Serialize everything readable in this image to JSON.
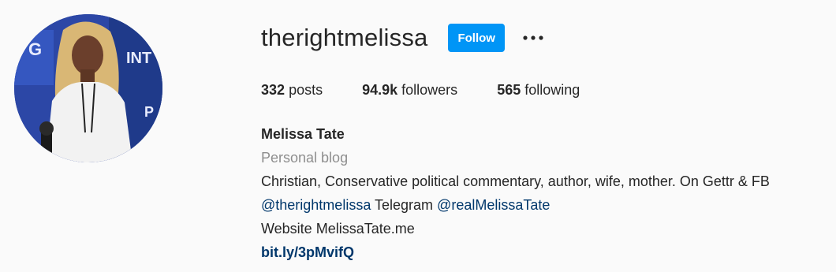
{
  "profile": {
    "username": "therightmelissa",
    "follow_label": "Follow",
    "more_icon": "more-options-icon",
    "stats": {
      "posts_count": "332",
      "posts_label": "posts",
      "followers_count": "94.9k",
      "followers_label": "followers",
      "following_count": "565",
      "following_label": "following"
    },
    "bio": {
      "full_name": "Melissa Tate",
      "category": "Personal blog",
      "description": "Christian, Conservative political commentary, author, wife, mother. On Gettr & FB",
      "mention_1": "@therightmelissa",
      "telegram_text": " Telegram ",
      "mention_2": "@realMelissaTate",
      "website_line": "Website MelissaTate.me",
      "external_link": "bit.ly/3pMvifQ"
    }
  },
  "colors": {
    "background": "#fafafa",
    "follow_button": "#0095f6",
    "link": "#00376b",
    "category_gray": "#8e8e8e",
    "text": "#262626"
  }
}
